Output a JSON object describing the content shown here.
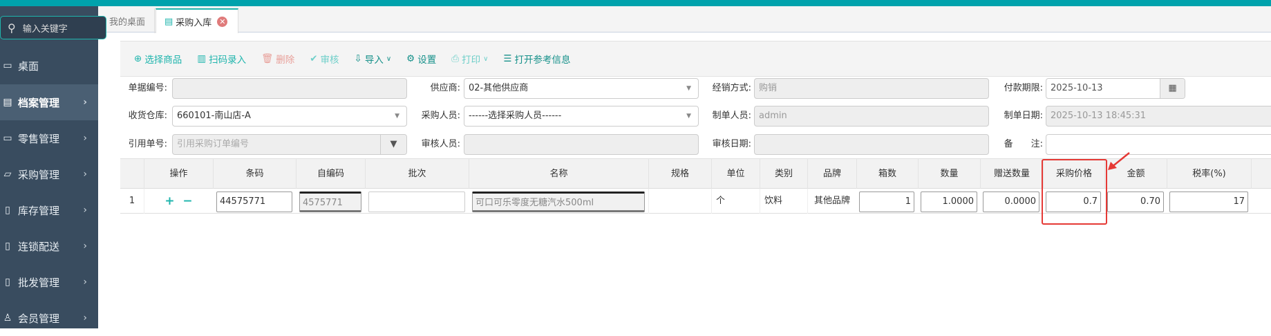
{
  "sidebar": {
    "search_placeholder": "输入关键字",
    "items": [
      {
        "label": "桌面",
        "icon": "desktop-icon"
      },
      {
        "label": "档案管理",
        "icon": "archive-icon",
        "active": true
      },
      {
        "label": "零售管理",
        "icon": "retail-icon"
      },
      {
        "label": "采购管理",
        "icon": "purchase-icon"
      },
      {
        "label": "库存管理",
        "icon": "inventory-icon"
      },
      {
        "label": "连锁配送",
        "icon": "delivery-icon"
      },
      {
        "label": "批发管理",
        "icon": "wholesale-icon"
      },
      {
        "label": "会员管理",
        "icon": "member-icon"
      }
    ]
  },
  "tabs": [
    {
      "label": "我的桌面"
    },
    {
      "label": "采购入库",
      "active": true
    }
  ],
  "toolbar": {
    "select_goods": "选择商品",
    "scan": "扫码录入",
    "delete": "删除",
    "audit": "审核",
    "import": "导入",
    "settings": "设置",
    "print": "打印",
    "reference": "打开参考信息"
  },
  "form": {
    "doc_no": {
      "label": "单据编号:",
      "value": ""
    },
    "supplier": {
      "label": "供应商:",
      "value": "02-其他供应商"
    },
    "dist_mode": {
      "label": "经销方式:",
      "value": "购销"
    },
    "pay_due": {
      "label": "付款期限:",
      "value": "2025-10-13"
    },
    "warehouse": {
      "label": "收货仓库:",
      "value": "660101-南山店-A"
    },
    "buyer": {
      "label": "采购人员:",
      "value": "------选择采购人员------"
    },
    "maker": {
      "label": "制单人员:",
      "value": "admin"
    },
    "make_date": {
      "label": "制单日期:",
      "value": "2025-10-13 18:45:31"
    },
    "ref_no": {
      "label": "引用单号:",
      "placeholder": "引用采购订单编号"
    },
    "auditor": {
      "label": "审核人员:",
      "value": ""
    },
    "audit_date": {
      "label": "审核日期:",
      "value": ""
    },
    "remark": {
      "label": "备　　注:",
      "value": ""
    }
  },
  "table": {
    "headers": [
      "",
      "操作",
      "条码",
      "自编码",
      "批次",
      "名称",
      "规格",
      "单位",
      "类别",
      "品牌",
      "箱数",
      "数量",
      "赠送数量",
      "采购价格",
      "金额",
      "税率(%)"
    ],
    "row": {
      "index": "1",
      "add": "+",
      "remove": "−",
      "barcode": "44575771",
      "code": "4575771",
      "batch": "",
      "name": "可口可乐零度无糖汽水500ml",
      "spec": "",
      "unit": "个",
      "category": "饮料",
      "brand": "其他品牌",
      "boxes": "1",
      "qty": "1.0000",
      "gift_qty": "0.0000",
      "price": "0.7",
      "amount": "0.70",
      "tax": "17"
    }
  },
  "colors": {
    "accent": "#1fb5ad",
    "sidebar": "#394c5f",
    "highlight": "#e53935"
  }
}
